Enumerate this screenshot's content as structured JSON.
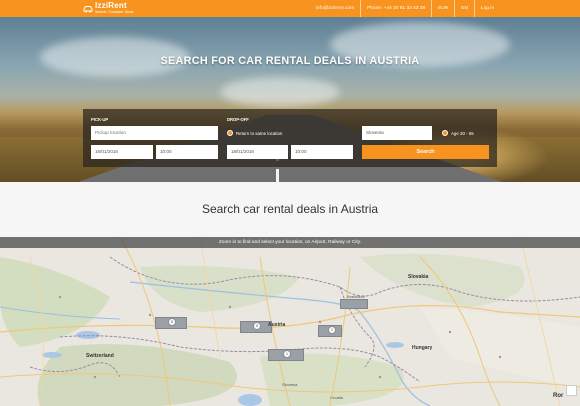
{
  "header": {
    "brand": "IzziRent",
    "tagline": "Search. Compare. Book.",
    "links": [
      "info@izzirent.com",
      "Phone: +44 20 81 33 43 38",
      "EUR",
      "EN",
      "Log in"
    ]
  },
  "hero": {
    "title": "SEARCH FOR CAR RENTAL DEALS IN AUSTRIA"
  },
  "search_form": {
    "pickup_label": "PICK-UP",
    "dropoff_label": "DROP-OFF",
    "pickup_location_placeholder": "Pickup location",
    "return_same_location": "Return to same location",
    "country_value": "Slovenia",
    "age_label": "Age 30 - 65",
    "pickup_date": "16/01/2016",
    "pickup_time": "10:00",
    "dropoff_date": "18/01/2016",
    "dropoff_time": "10:00",
    "search_button": "Search"
  },
  "section": {
    "title": "Search car rental deals in Austria"
  },
  "map": {
    "instruction": "Zoom in to find and select your location, on Airport, Railway or City.",
    "places": [
      "Slovakia",
      "Bratislava",
      "Austria",
      "Hungary",
      "Switzerland",
      "Slovenia",
      "Croatia",
      "Ror"
    ],
    "markers": [
      "8",
      "5",
      "2",
      "1"
    ]
  },
  "colors": {
    "brand_orange": "#f7931e",
    "panel_bg": "#2a2620"
  }
}
